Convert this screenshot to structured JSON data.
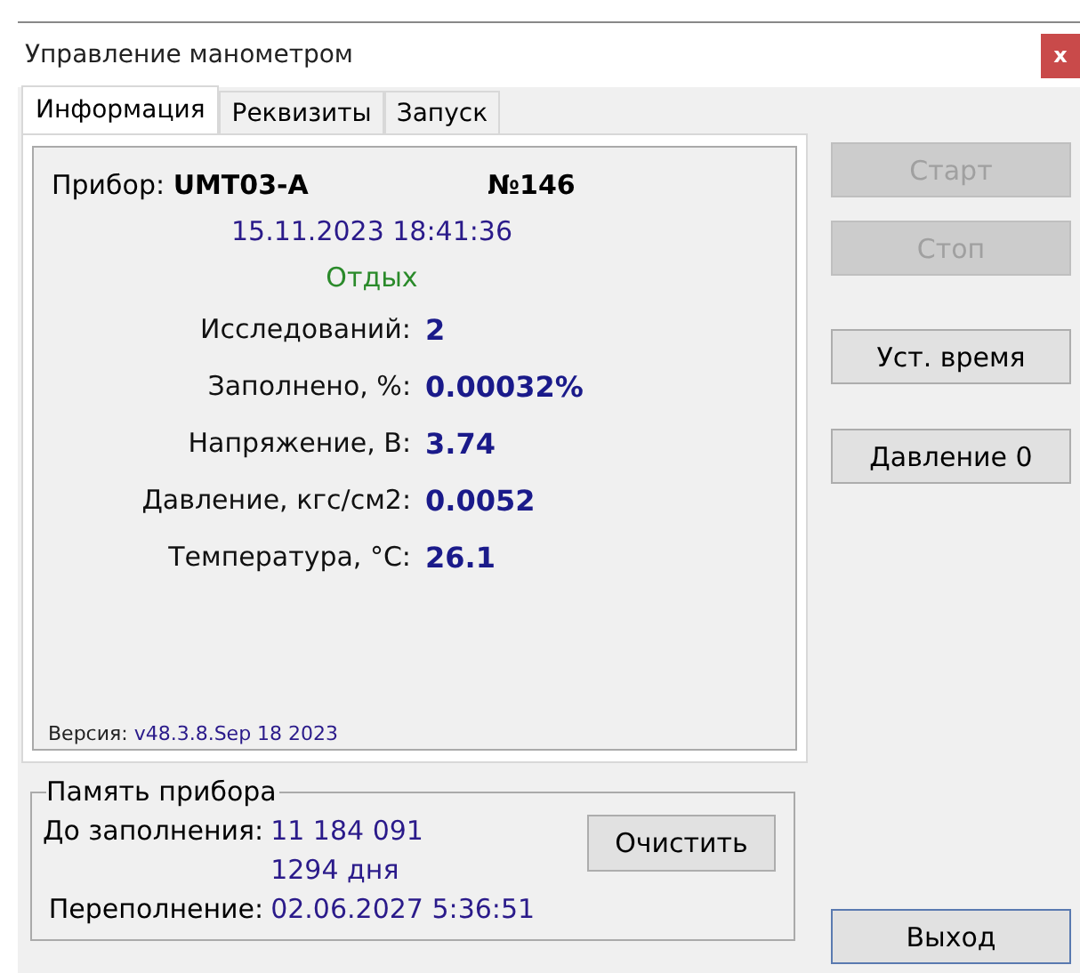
{
  "window": {
    "title": "Управление манометром",
    "close": "x"
  },
  "tabs": [
    {
      "label": "Информация",
      "selected": true
    },
    {
      "label": "Реквизиты",
      "selected": false
    },
    {
      "label": "Запуск",
      "selected": false
    }
  ],
  "info": {
    "device_label": "Прибор:",
    "device_model": "UMT03-A",
    "number": "№146",
    "datetime": "15.11.2023 18:41:36",
    "status": "Отдых",
    "readings": [
      {
        "label": "Исследований:",
        "value": "2"
      },
      {
        "label": "Заполнено, %:",
        "value": "0.00032%"
      },
      {
        "label": "Напряжение, В:",
        "value": "3.74"
      },
      {
        "label": "Давление, кгс/см2:",
        "value": "0.0052"
      },
      {
        "label": "Температура, °C:",
        "value": "26.1"
      }
    ],
    "version_label": "Версия:",
    "version": "v48.3.8.Sep 18 2023"
  },
  "memory": {
    "title": "Память прибора",
    "until_full_label": "До заполнения:",
    "until_full": "11 184 091",
    "days": "1294 дня",
    "overflow_label": "Переполнение:",
    "overflow": "02.06.2027 5:36:51",
    "clear_button": "Очистить"
  },
  "buttons": [
    {
      "label": "Старт",
      "disabled": true
    },
    {
      "label": "Стоп",
      "disabled": true
    },
    {
      "label": "Уст. время",
      "disabled": false
    },
    {
      "label": "Давление 0",
      "disabled": false
    }
  ],
  "exit_button": "Выход"
}
